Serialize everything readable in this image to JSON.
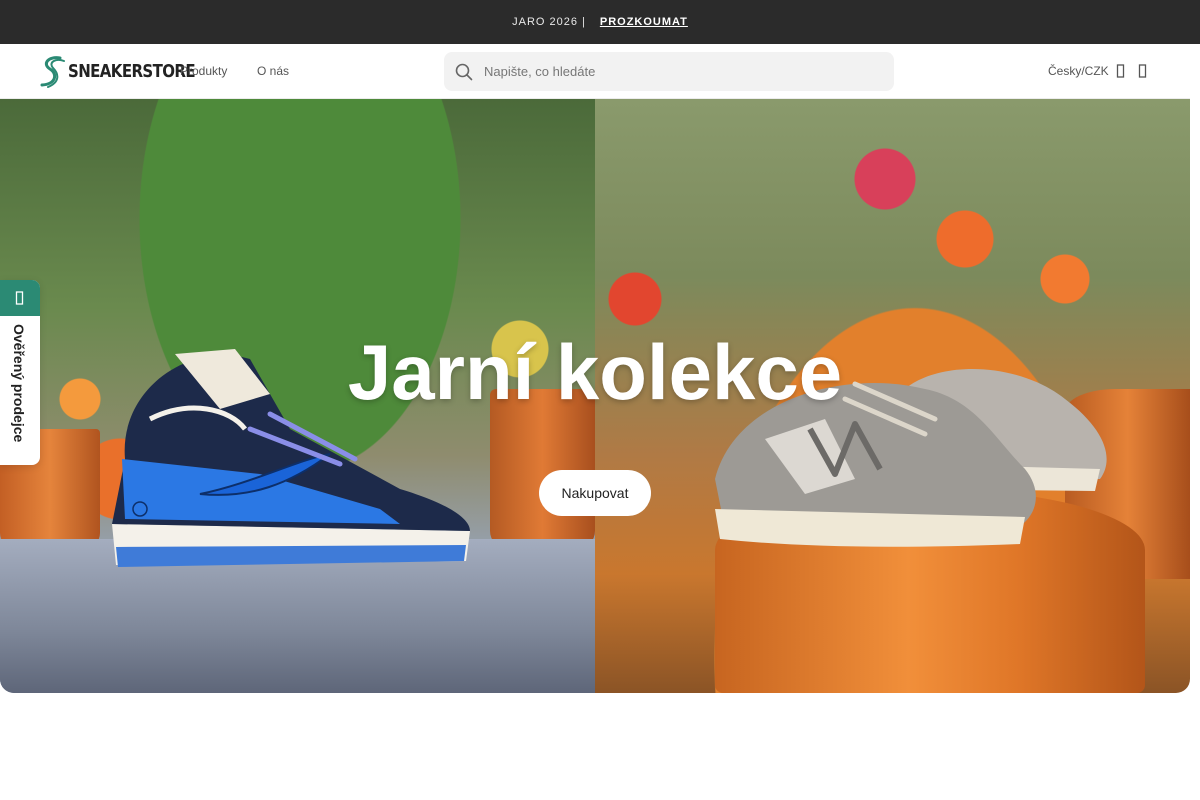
{
  "announcement": {
    "text": "JARO 2026",
    "separator": "|",
    "cta_label": "PROZKOUMAT"
  },
  "header": {
    "logo_text": "SNEAKERSTORE",
    "nav": [
      {
        "label": "Produkty"
      },
      {
        "label": "O nás"
      }
    ],
    "search": {
      "placeholder": "Napište, co hledáte",
      "value": ""
    },
    "locale_label": "Česky/CZK",
    "icons": [
      "account-icon",
      "cart-icon"
    ]
  },
  "hero": {
    "title": "Jarní kolekce",
    "button_label": "Nakupovat"
  },
  "side_tab": {
    "label": "Ověřený prodejce",
    "icon": "verified-icon"
  },
  "colors": {
    "announcement_bg": "#2b2b2b",
    "accent_green": "#2b8a74",
    "text_dark": "#222222"
  }
}
